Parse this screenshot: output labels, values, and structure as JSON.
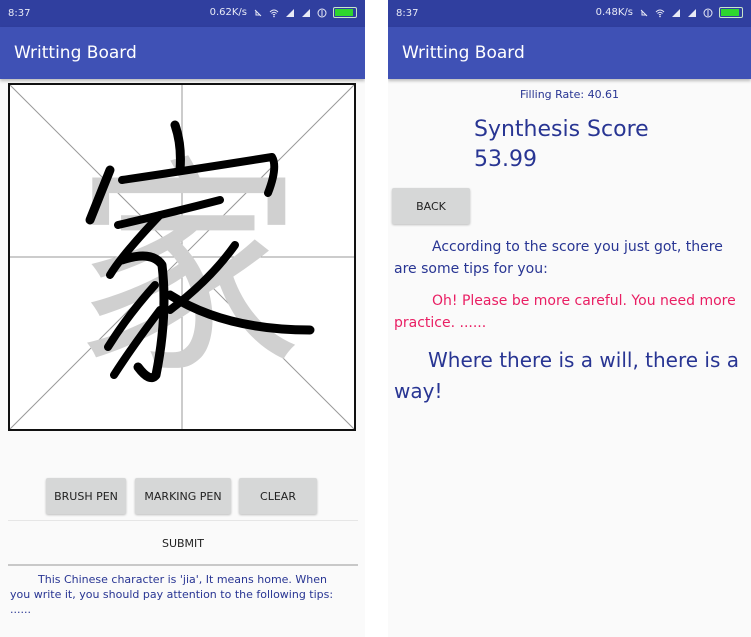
{
  "left": {
    "status": {
      "time": "8:37",
      "speed": "0.62K/s"
    },
    "app_title": "Writting Board",
    "buttons": {
      "brush": "BRUSH PEN",
      "marking": "MARKING PEN",
      "clear": "CLEAR",
      "submit": "SUBMIT"
    },
    "hint": "This Chinese character is 'jia', It means home. When you write it, you should pay attention to the following tips: ......",
    "character": {
      "reference": "家",
      "stroke_color": "#000000",
      "reference_color": "#d0d0d0"
    }
  },
  "right": {
    "status": {
      "time": "8:37",
      "speed": "0.48K/s"
    },
    "app_title": "Writting Board",
    "filling_rate": "Filling Rate: 40.61",
    "score_label": "Synthesis Score",
    "score_value": "53.99",
    "back": "BACK",
    "tips_intro": "According to the score you just got, there are some tips for you:",
    "tips_warn": "Oh! Please be more careful. You need more practice. ......",
    "motto": "Where there is a will, there is a way!"
  },
  "colors": {
    "primary": "#3f51b5",
    "primary_dark": "#303f9f",
    "text": "#283593",
    "warn": "#e91e63"
  },
  "icons": [
    "mute-icon",
    "wifi-icon",
    "signal-icon",
    "signal-icon",
    "data-icon",
    "battery-icon"
  ]
}
